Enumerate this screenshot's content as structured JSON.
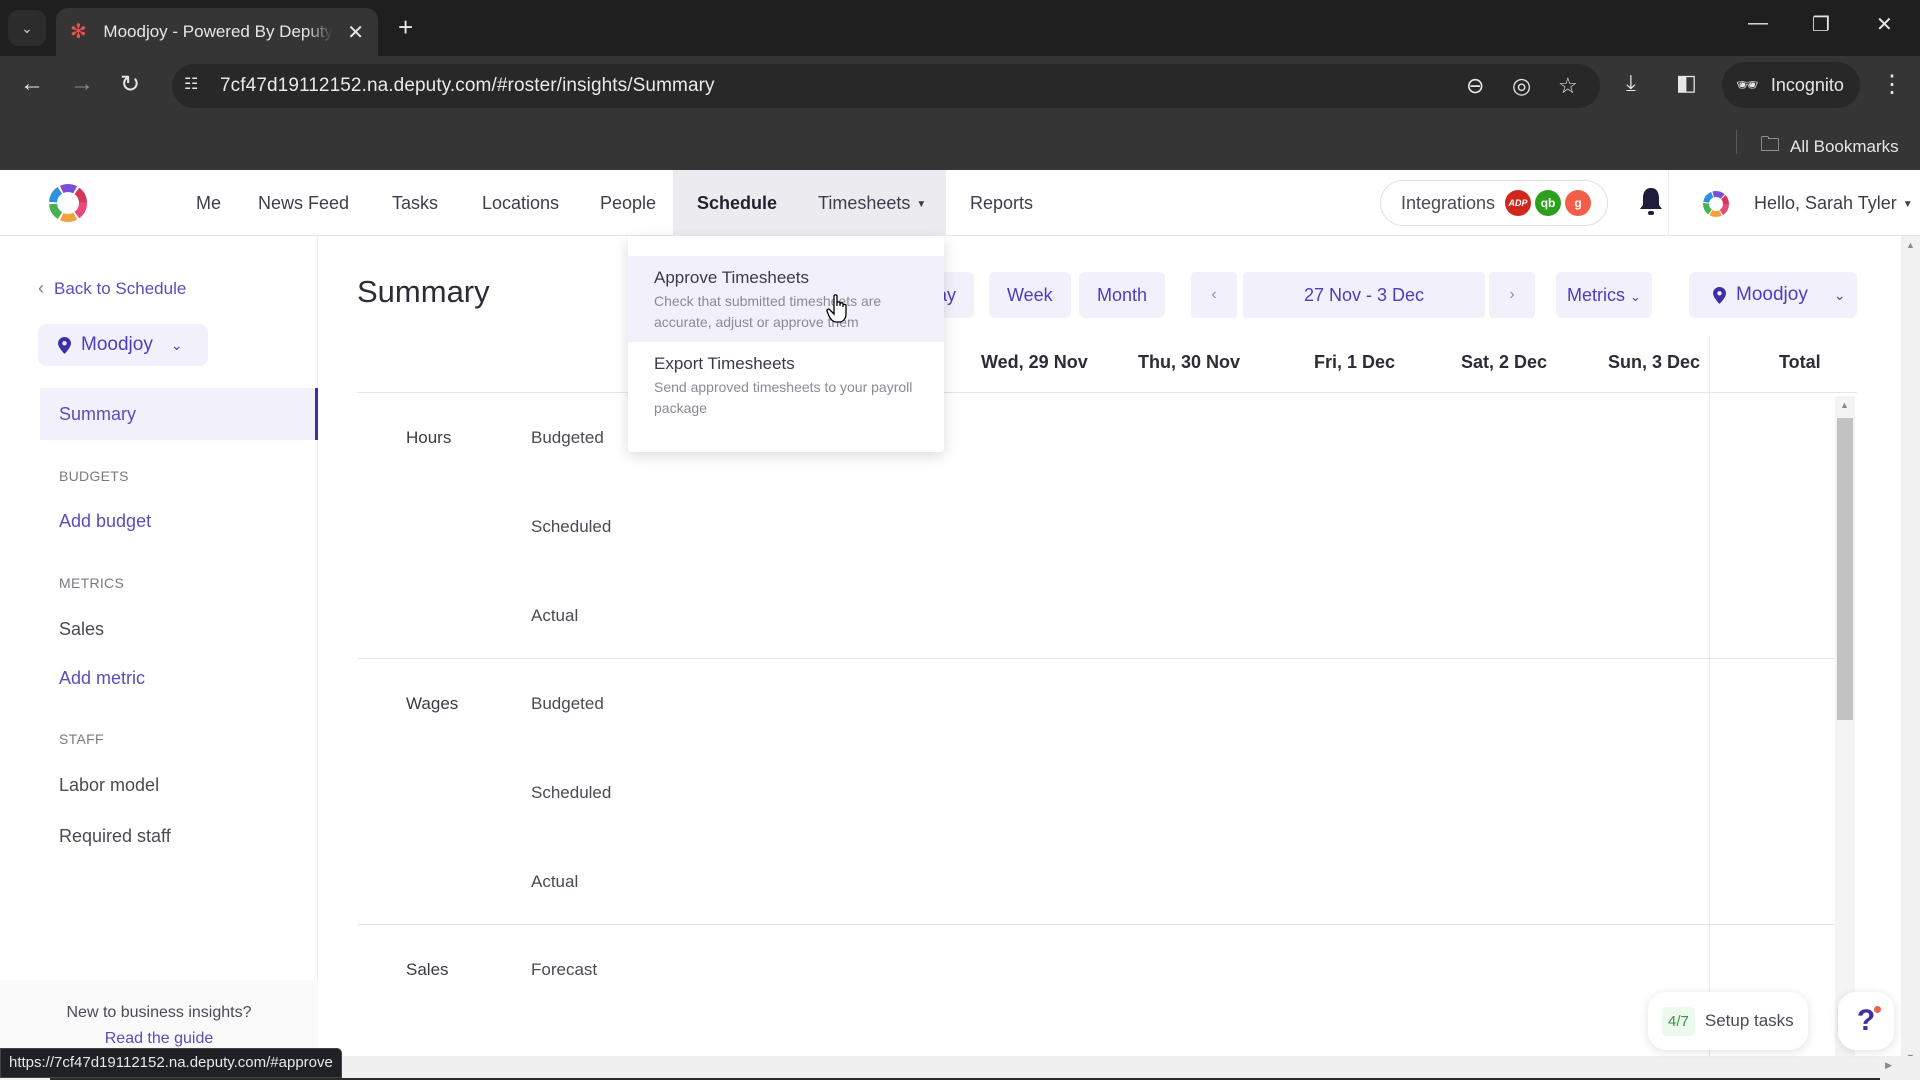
{
  "browser": {
    "tab_title": "Moodjoy - Powered By Deputy",
    "url": "7cf47d19112152.na.deputy.com/#roster/insights/Summary",
    "incognito_label": "Incognito",
    "bookmarks_label": "All Bookmarks",
    "status_url": "https://7cf47d19112152.na.deputy.com/#approve"
  },
  "nav": {
    "items": [
      {
        "label": "Me"
      },
      {
        "label": "News Feed"
      },
      {
        "label": "Tasks"
      },
      {
        "label": "Locations"
      },
      {
        "label": "People"
      },
      {
        "label": "Schedule",
        "active": true
      },
      {
        "label": "Timesheets",
        "has_dropdown": true,
        "open": true
      },
      {
        "label": "Reports"
      }
    ],
    "integrations_label": "Integrations",
    "integrations": [
      {
        "name": "ADP",
        "short": "ADP",
        "color": "#d0271d"
      },
      {
        "name": "QuickBooks",
        "short": "qb",
        "color": "#2ca01c"
      },
      {
        "name": "Gusto",
        "short": "g",
        "color": "#f45d48"
      }
    ],
    "greeting": "Hello, Sarah Tyler"
  },
  "timesheets_menu": {
    "items": [
      {
        "title": "Approve Timesheets",
        "description": "Check that submitted timesheets are accurate, adjust or approve them",
        "hovered": true
      },
      {
        "title": "Export Timesheets",
        "description": "Send approved timesheets to your payroll package"
      }
    ]
  },
  "sidebar": {
    "back_label": "Back to Schedule",
    "location": "Moodjoy",
    "active_item": "Summary",
    "sections": [
      {
        "heading": "BUDGETS",
        "items": [
          {
            "label": "Add budget",
            "type": "action"
          }
        ]
      },
      {
        "heading": "METRICS",
        "items": [
          {
            "label": "Sales",
            "type": "link"
          },
          {
            "label": "Add metric",
            "type": "action"
          }
        ]
      },
      {
        "heading": "STAFF",
        "items": [
          {
            "label": "Labor model",
            "type": "link"
          },
          {
            "label": "Required staff",
            "type": "link"
          }
        ]
      }
    ],
    "guide_question": "New to business insights?",
    "guide_link": "Read the guide"
  },
  "main": {
    "title": "Summary",
    "view_options": [
      "Day",
      "Week",
      "Month"
    ],
    "view_partial_label": "ay",
    "date_range": "27 Nov - 3 Dec",
    "prev_label": "‹",
    "next_label": "›",
    "metrics_label": "Metrics",
    "location_label": "Moodjoy",
    "columns": [
      "Wed, 29 Nov",
      "Thu, 30 Nov",
      "Fri, 1 Dec",
      "Sat, 2 Dec",
      "Sun, 3 Dec",
      "Total"
    ],
    "groups": [
      {
        "label": "Hours",
        "rows": [
          "Budgeted",
          "Scheduled",
          "Actual"
        ]
      },
      {
        "label": "Wages",
        "rows": [
          "Budgeted",
          "Scheduled",
          "Actual"
        ]
      },
      {
        "label": "Sales",
        "rows": [
          "Forecast"
        ]
      }
    ]
  },
  "floating": {
    "setup_progress": "4/7",
    "setup_label": "Setup tasks",
    "help_label": "?"
  },
  "colors": {
    "accent": "#4b3ec1",
    "accent_bg": "#f2f1fb"
  }
}
